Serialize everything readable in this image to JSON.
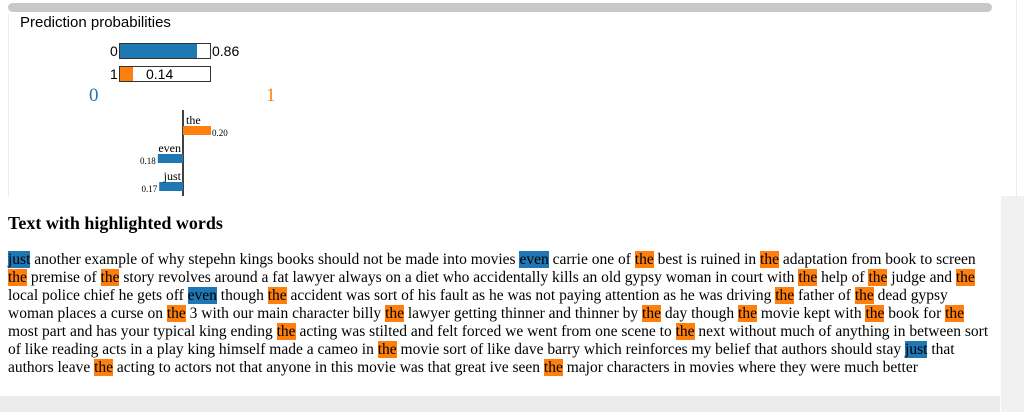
{
  "colors": {
    "class0": "#1f77b4",
    "class1": "#ff7f0e"
  },
  "prediction": {
    "title": "Prediction probabilities",
    "rows": [
      {
        "label": "0",
        "value": 0.86,
        "value_text": "0.86",
        "color": "#1f77b4"
      },
      {
        "label": "1",
        "value": 0.14,
        "value_text": "0.14",
        "color": "#ff7f0e"
      }
    ]
  },
  "classes": {
    "left": "0",
    "right": "1"
  },
  "chart_data": {
    "type": "bar",
    "orientation": "horizontal",
    "categories": [
      "the",
      "even",
      "just"
    ],
    "values": [
      0.2,
      -0.18,
      -0.17
    ],
    "labels": [
      "0.20",
      "0.18",
      "0.17"
    ],
    "title": "",
    "xlabel": "",
    "ylabel": ""
  },
  "text_section": {
    "heading": "Text with highlighted words",
    "tokens": [
      {
        "t": "just",
        "h": "blue"
      },
      {
        "t": " another example of why stepehn kings books should not be made into movies "
      },
      {
        "t": "even",
        "h": "blue"
      },
      {
        "t": " carrie one of "
      },
      {
        "t": "the",
        "h": "orange"
      },
      {
        "t": " best is ruined in "
      },
      {
        "t": "the",
        "h": "orange"
      },
      {
        "t": " adaptation from book to screen "
      },
      {
        "t": "the",
        "h": "orange"
      },
      {
        "t": " premise of "
      },
      {
        "t": "the",
        "h": "orange"
      },
      {
        "t": " story revolves around a fat lawyer always on a diet who accidentally kills an old gypsy woman in court with "
      },
      {
        "t": "the",
        "h": "orange"
      },
      {
        "t": " help of "
      },
      {
        "t": "the",
        "h": "orange"
      },
      {
        "t": " judge and "
      },
      {
        "t": "the",
        "h": "orange"
      },
      {
        "t": " local police chief he gets off "
      },
      {
        "t": "even",
        "h": "blue"
      },
      {
        "t": " though "
      },
      {
        "t": "the",
        "h": "orange"
      },
      {
        "t": " accident was sort of his fault as he was not paying attention as he was driving "
      },
      {
        "t": "the",
        "h": "orange"
      },
      {
        "t": " father of "
      },
      {
        "t": "the",
        "h": "orange"
      },
      {
        "t": " dead gypsy woman places a curse on "
      },
      {
        "t": "the",
        "h": "orange"
      },
      {
        "t": " 3 with our main character billy "
      },
      {
        "t": "the",
        "h": "orange"
      },
      {
        "t": " lawyer getting thinner and thinner by "
      },
      {
        "t": "the",
        "h": "orange"
      },
      {
        "t": " day though "
      },
      {
        "t": "the",
        "h": "orange"
      },
      {
        "t": " movie kept with "
      },
      {
        "t": "the",
        "h": "orange"
      },
      {
        "t": " book for "
      },
      {
        "t": "the",
        "h": "orange"
      },
      {
        "t": " most part and has your typical king ending "
      },
      {
        "t": "the",
        "h": "orange"
      },
      {
        "t": " acting was stilted and felt forced we went from one scene to "
      },
      {
        "t": "the",
        "h": "orange"
      },
      {
        "t": " next without much of anything in between sort of like reading acts in a play king himself made a cameo in "
      },
      {
        "t": "the",
        "h": "orange"
      },
      {
        "t": " movie sort of like dave barry which reinforces my belief that authors should stay "
      },
      {
        "t": "just",
        "h": "blue"
      },
      {
        "t": " that authors leave "
      },
      {
        "t": "the",
        "h": "orange"
      },
      {
        "t": " acting to actors not that anyone in this movie was that great ive seen "
      },
      {
        "t": "the",
        "h": "orange"
      },
      {
        "t": " major characters in movies where they were much better"
      }
    ]
  }
}
